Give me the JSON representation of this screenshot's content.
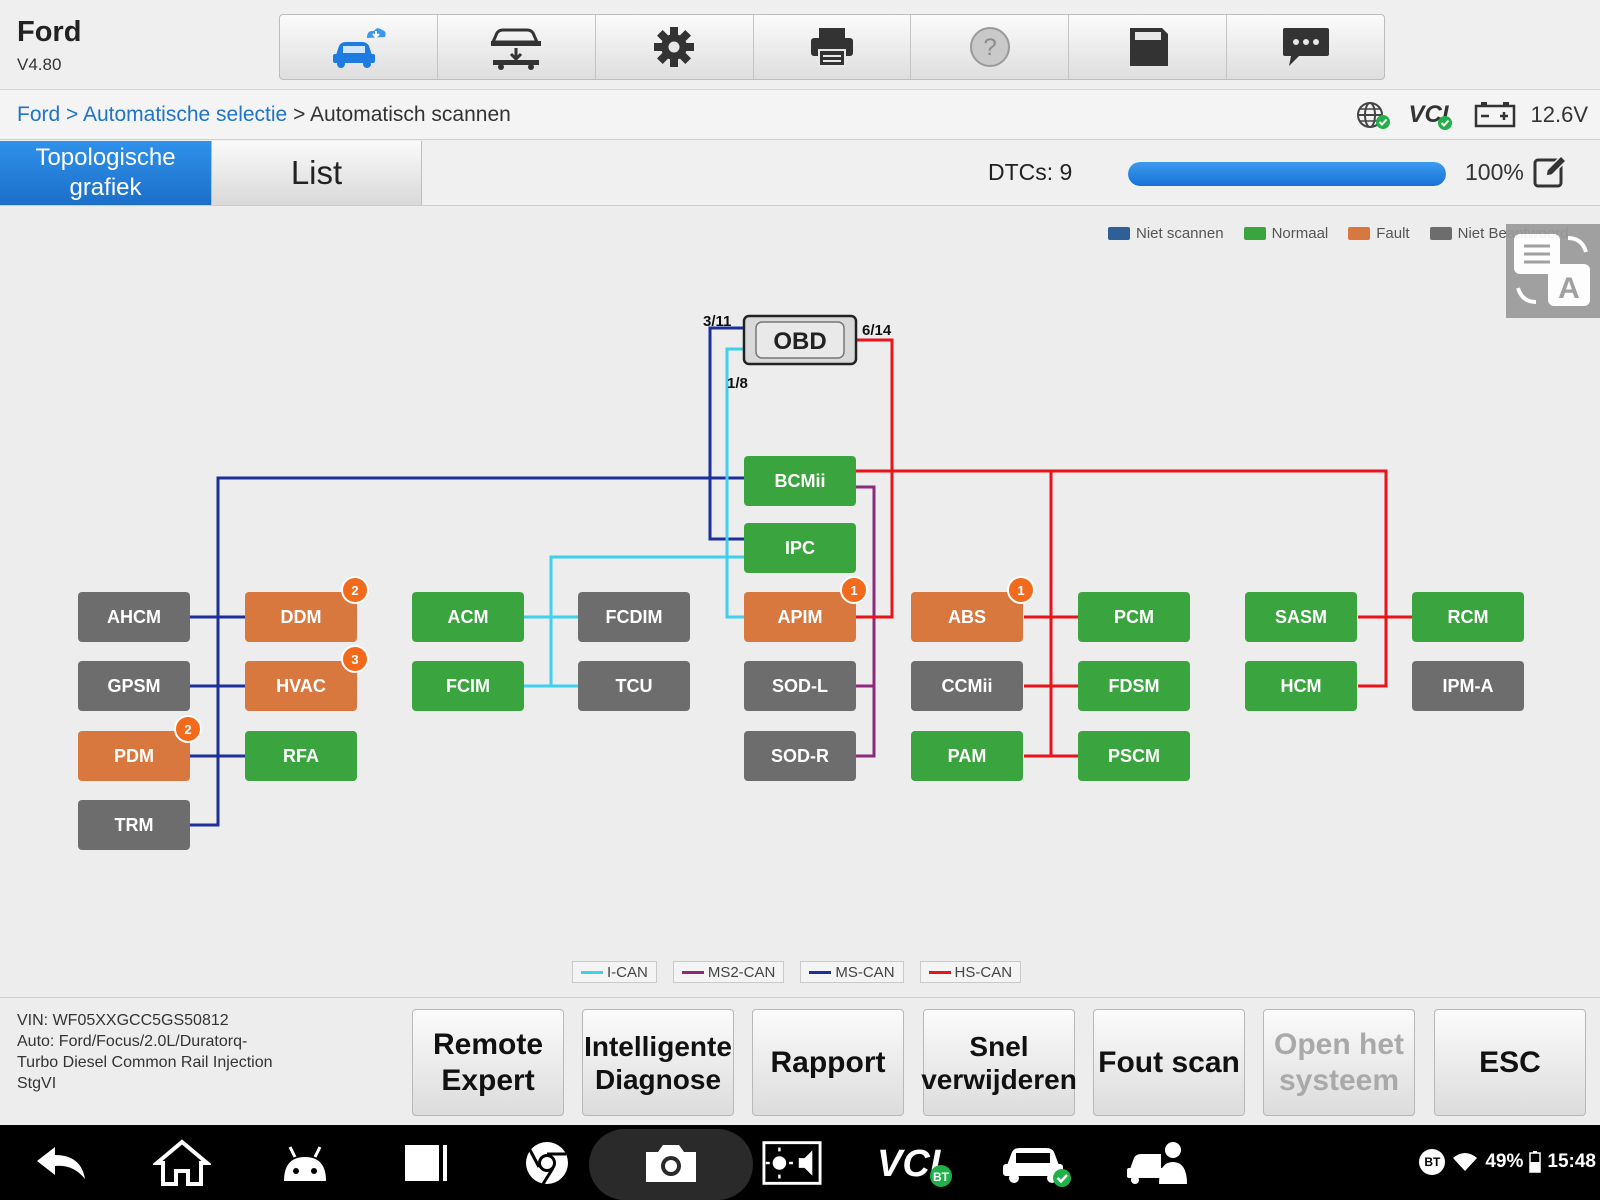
{
  "app": {
    "title": "Ford",
    "version": "V4.80"
  },
  "toolbar": {
    "buttons": [
      {
        "name": "vehicle-cloud",
        "icon": "car-cloud-icon"
      },
      {
        "name": "vehicle-lift",
        "icon": "car-lift-icon"
      },
      {
        "name": "settings",
        "icon": "gear-icon"
      },
      {
        "name": "print",
        "icon": "printer-icon"
      },
      {
        "name": "help",
        "icon": "help-icon"
      },
      {
        "name": "save",
        "icon": "save-icon"
      },
      {
        "name": "feedback",
        "icon": "chat-icon"
      }
    ]
  },
  "breadcrumb": {
    "item1": "Ford",
    "sep1": " > ",
    "item2": "Automatische selectie",
    "sep2": " > ",
    "item3": "Automatisch scannen"
  },
  "status": {
    "vci": "VCI",
    "voltage": "12.6V"
  },
  "tabs": {
    "topology_line1": "Topologische",
    "topology_line2": "grafiek",
    "list": "List"
  },
  "scan": {
    "dtcs": "DTCs: 9",
    "progress": 100,
    "progress_label": "100%"
  },
  "legend": [
    {
      "label": "Niet scannen",
      "color": "#2e5f96"
    },
    {
      "label": "Normaal",
      "color": "#3aa53e"
    },
    {
      "label": "Fault",
      "color": "#d8783f"
    },
    {
      "label": "Niet Beantwoord",
      "color": "#6d6d6d"
    }
  ],
  "obd": {
    "label": "OBD",
    "pin_ms": "3/11",
    "pin_hs": "6/14",
    "pin_i": "1/8"
  },
  "colors": {
    "normal": "#3aa53e",
    "fault": "#d8783f",
    "noresp": "#6d6d6d",
    "badge": "#f26b1d",
    "i_can": "#3fd0f0",
    "ms2_can": "#8c2a7c",
    "ms_can": "#1d2f9a",
    "hs_can": "#e8141a"
  },
  "nodes": [
    {
      "id": "BCMii",
      "status": "normal",
      "dtc": 0
    },
    {
      "id": "IPC",
      "status": "normal",
      "dtc": 0
    },
    {
      "id": "APIM",
      "status": "fault",
      "dtc": 1
    },
    {
      "id": "SOD-L",
      "status": "noresp",
      "dtc": 0
    },
    {
      "id": "SOD-R",
      "status": "noresp",
      "dtc": 0
    },
    {
      "id": "AHCM",
      "status": "noresp",
      "dtc": 0
    },
    {
      "id": "GPSM",
      "status": "noresp",
      "dtc": 0
    },
    {
      "id": "PDM",
      "status": "fault",
      "dtc": 2
    },
    {
      "id": "TRM",
      "status": "noresp",
      "dtc": 0
    },
    {
      "id": "DDM",
      "status": "fault",
      "dtc": 2
    },
    {
      "id": "HVAC",
      "status": "fault",
      "dtc": 3
    },
    {
      "id": "RFA",
      "status": "normal",
      "dtc": 0
    },
    {
      "id": "ACM",
      "status": "normal",
      "dtc": 0
    },
    {
      "id": "FCIM",
      "status": "normal",
      "dtc": 0
    },
    {
      "id": "FCDIM",
      "status": "noresp",
      "dtc": 0
    },
    {
      "id": "TCU",
      "status": "noresp",
      "dtc": 0
    },
    {
      "id": "ABS",
      "status": "fault",
      "dtc": 1
    },
    {
      "id": "CCMii",
      "status": "noresp",
      "dtc": 0
    },
    {
      "id": "PAM",
      "status": "normal",
      "dtc": 0
    },
    {
      "id": "PCM",
      "status": "normal",
      "dtc": 0
    },
    {
      "id": "FDSM",
      "status": "normal",
      "dtc": 0
    },
    {
      "id": "PSCM",
      "status": "normal",
      "dtc": 0
    },
    {
      "id": "SASM",
      "status": "normal",
      "dtc": 0
    },
    {
      "id": "HCM",
      "status": "normal",
      "dtc": 0
    },
    {
      "id": "RCM",
      "status": "normal",
      "dtc": 0
    },
    {
      "id": "IPM-A",
      "status": "noresp",
      "dtc": 0
    }
  ],
  "bus_legend": [
    {
      "label": "I-CAN",
      "color": "#3fd0f0"
    },
    {
      "label": "MS2-CAN",
      "color": "#8c2a7c"
    },
    {
      "label": "MS-CAN",
      "color": "#1d2f9a"
    },
    {
      "label": "HS-CAN",
      "color": "#e8141a"
    }
  ],
  "vehicle": {
    "vin": "VIN: WF05XXGCC5GS50812",
    "auto": "Auto: Ford/Focus/2.0L/Duratorq-Turbo Diesel Common Rail Injection StgVI"
  },
  "footer_buttons": {
    "remote_expert": "Remote Expert",
    "intelligent_diag": "Intelligente Diagnose",
    "report": "Rapport",
    "quick_clear": "Snel verwijderen",
    "fault_scan": "Fout scan",
    "open_system": "Open het systeem",
    "esc": "ESC"
  },
  "system_status": {
    "bt": "BT",
    "battery": "49%",
    "time": "15:48"
  }
}
